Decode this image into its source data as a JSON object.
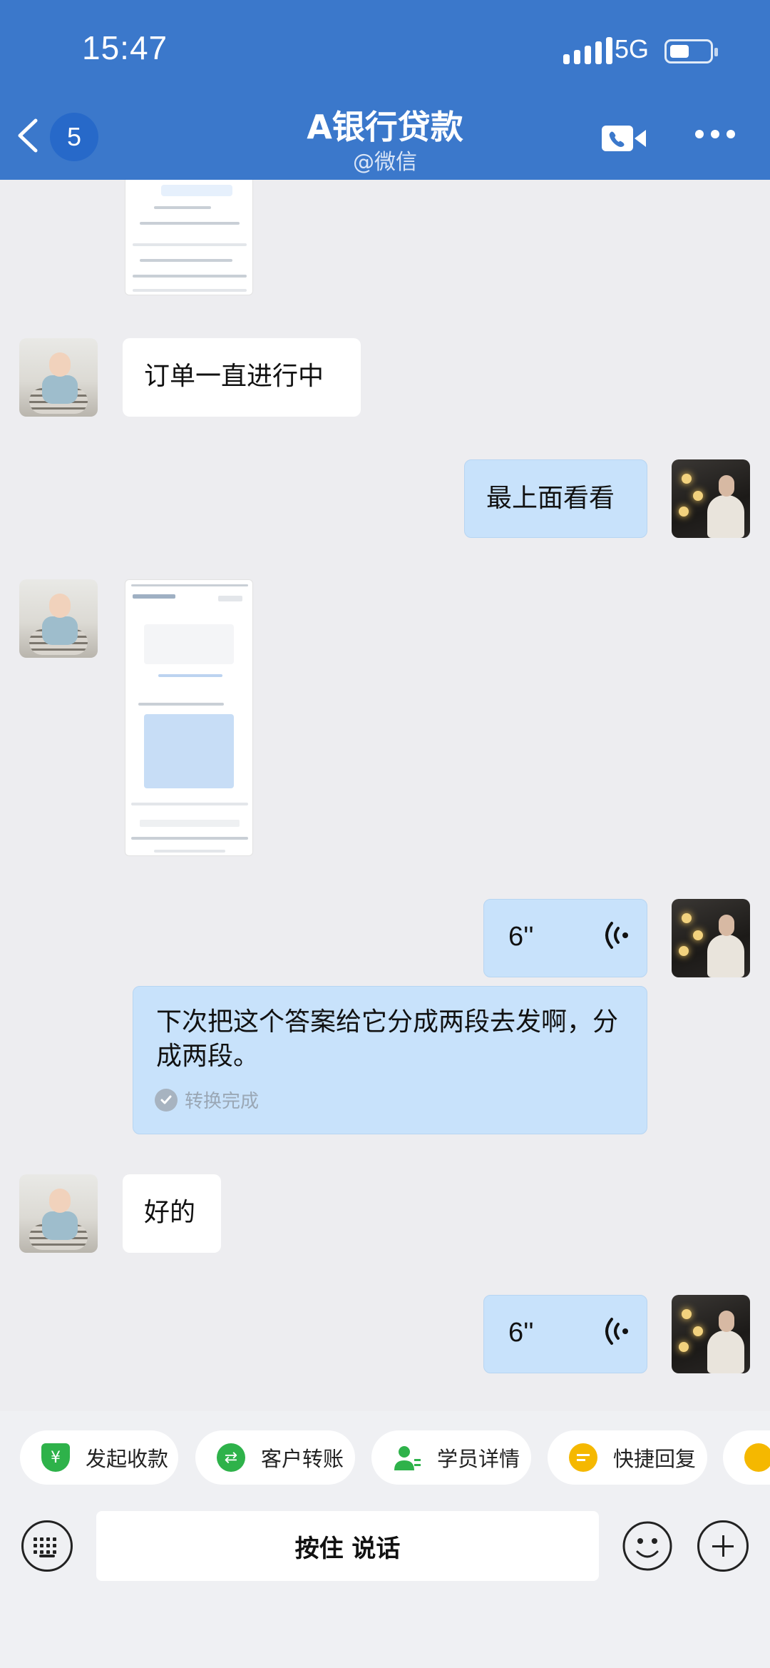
{
  "status_bar": {
    "time": "15:47",
    "network": "5G"
  },
  "header": {
    "unread_count": "5",
    "title": "A银行贷款",
    "subtitle": "@微信"
  },
  "messages": {
    "m1": {
      "text": "订单一直进行中"
    },
    "m2": {
      "text": "最上面看看"
    },
    "m3": {
      "duration": "6''"
    },
    "m3_transcript": {
      "text": "下次把这个答案给它分成两段去发啊，分成两段。",
      "status": "转换完成"
    },
    "m4": {
      "text": "好的"
    },
    "m5": {
      "duration": "6''"
    }
  },
  "quick_actions": [
    {
      "label": "发起收款",
      "color": "#2eb24a"
    },
    {
      "label": "客户转账",
      "color": "#2eb24a"
    },
    {
      "label": "学员详情",
      "color": "#2eb24a"
    },
    {
      "label": "快捷回复",
      "color": "#f5b800"
    }
  ],
  "input_bar": {
    "hold_to_talk": "按住 说话"
  },
  "colors": {
    "header_bg": "#3b78cb",
    "bubble_out": "#c8e2fb",
    "bubble_in": "#ffffff",
    "chat_bg": "#ededf0"
  },
  "icons": [
    "back-arrow-icon",
    "video-call-icon",
    "more-icon",
    "voice-wave-icon",
    "keyboard-icon",
    "emoji-icon",
    "plus-icon",
    "check-icon"
  ]
}
